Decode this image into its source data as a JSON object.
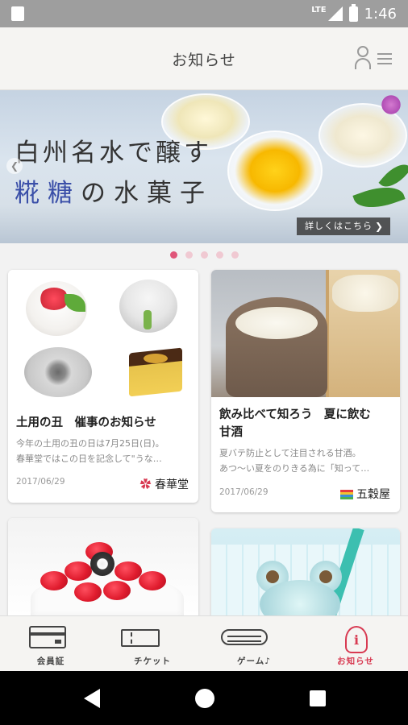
{
  "status_bar": {
    "network": "LTE",
    "time": "1:46"
  },
  "header": {
    "title": "お知らせ"
  },
  "banner": {
    "line1": "白州名水で醸す",
    "line2_accent": "糀糖",
    "line2_rest": "の水菓子",
    "detail_button": "詳しくはこちら",
    "slide_count": 5,
    "active_slide": 1
  },
  "news": [
    {
      "title": "土用の丑　催事のお知らせ",
      "excerpt_1": "今年の土用の丑の日は7月25日(日)。",
      "excerpt_2": "春華堂ではこの日を記念して\"うな…",
      "date": "2017/06/29",
      "brand": "春華堂"
    },
    {
      "title_1": "飲み比べて知ろう　夏に飲む",
      "title_2": "甘酒",
      "excerpt_1": "夏バテ防止として注目される甘酒。",
      "excerpt_2": "あつ〜い夏をのりきる為に「知って…",
      "date": "2017/06/29",
      "brand": "五穀屋"
    }
  ],
  "tabs": [
    {
      "label": "会員証",
      "icon": "member-card-icon"
    },
    {
      "label": "チケット",
      "icon": "ticket-icon"
    },
    {
      "label": "ゲーム♪",
      "icon": "game-icon"
    },
    {
      "label": "お知らせ",
      "icon": "info-icon",
      "active": true
    }
  ],
  "colors": {
    "accent": "#d83a52",
    "dot_inactive": "#f0c9d2",
    "dot_active": "#e0567a"
  }
}
